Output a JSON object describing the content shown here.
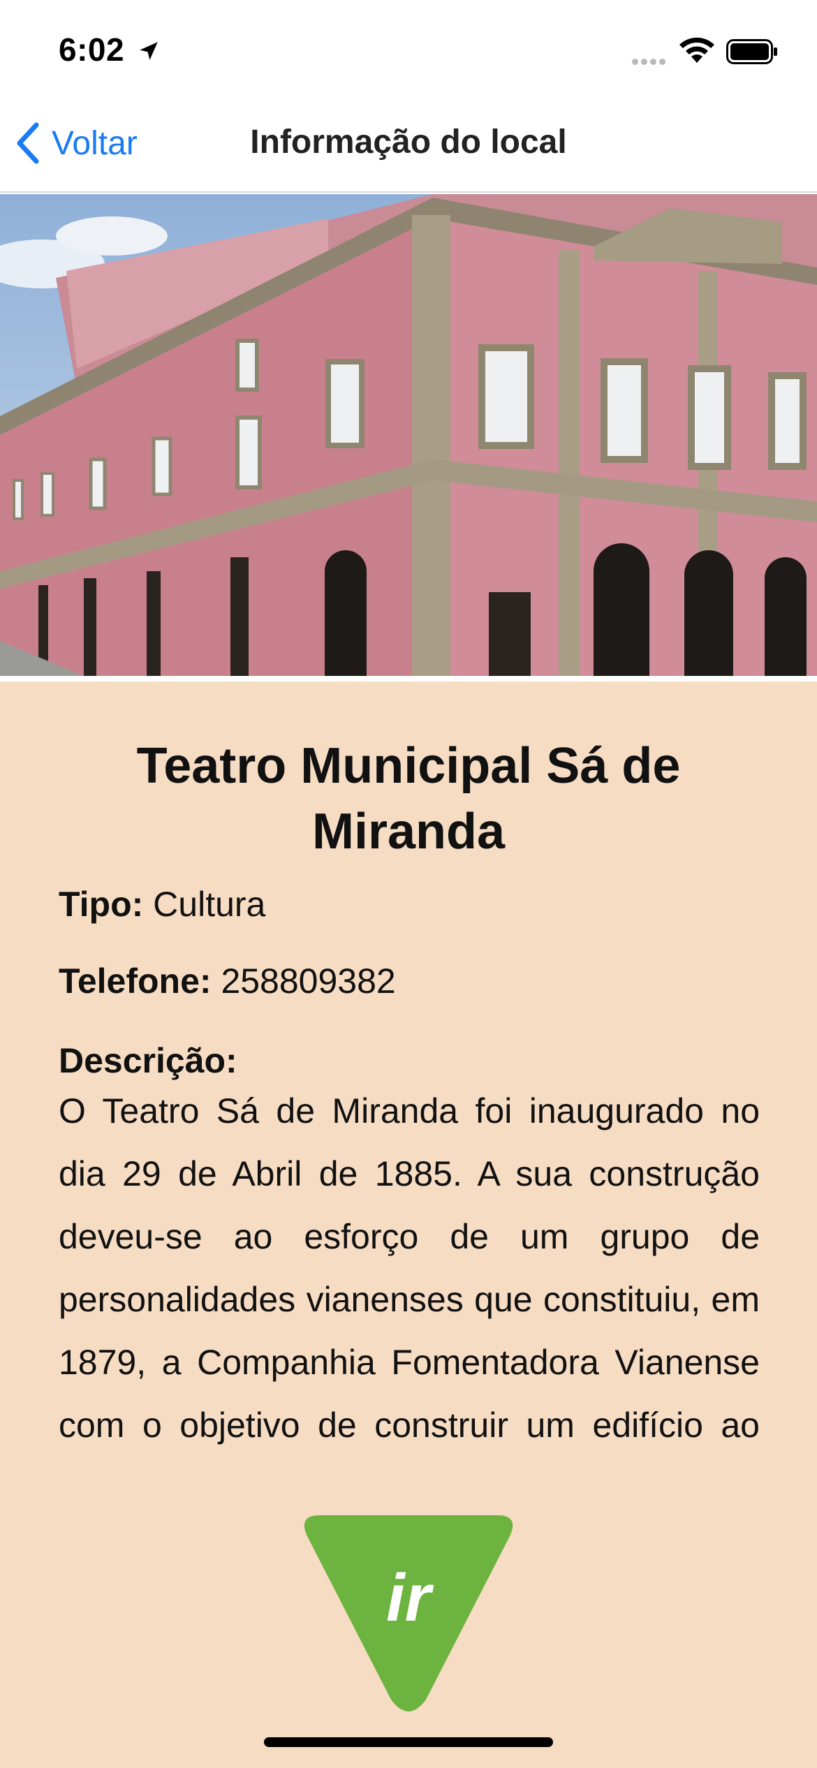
{
  "status_bar": {
    "time": "6:02",
    "icons": [
      "location-arrow-icon",
      "signal-icon",
      "wifi-icon",
      "battery-icon"
    ]
  },
  "nav": {
    "back_label": "Voltar",
    "title": "Informação do local",
    "accent_color": "#1a7cf2"
  },
  "hero": {
    "image": "photo-teatro-municipal"
  },
  "place": {
    "title": "Teatro Municipal Sá de Miranda",
    "type_label": "Tipo:",
    "type_value": "Cultura",
    "phone_label": "Telefone:",
    "phone_value": "258809382",
    "description_label": "Descrição:",
    "description": "O Teatro Sá de Miranda foi inaugurado no dia 29 de Abril de 1885. A sua construção deveu-se ao esforço de um grupo de personalidades vianenses que constituiu, em 1879, a Companhia Fomentadora Vianense com o objetivo de construir um edifício ao estilo da Época. Teatro à italiana"
  },
  "go_button": {
    "label": "ir",
    "color": "#6db33f"
  },
  "colors": {
    "content_background": "#f6dcc3"
  }
}
